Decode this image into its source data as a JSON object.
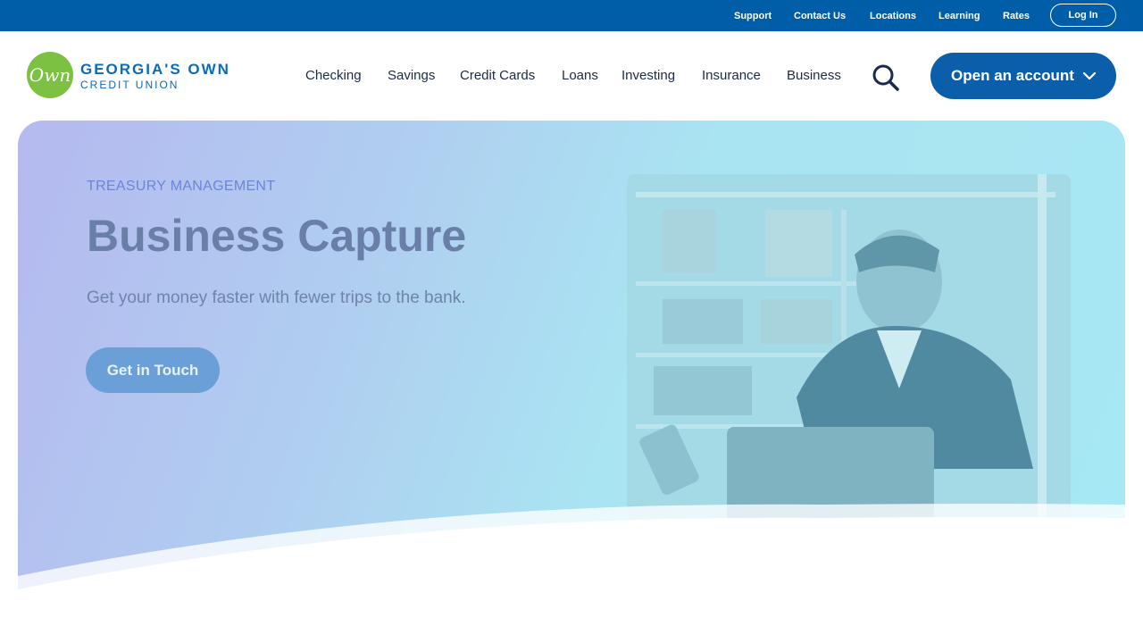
{
  "utility": {
    "links": [
      "Support",
      "Contact Us",
      "Locations",
      "Learning",
      "Rates"
    ],
    "login_label": "Log In"
  },
  "brand": {
    "logo_mark": "Own",
    "name": "GEORGIA'S OWN",
    "sub": "CREDIT UNION"
  },
  "nav": {
    "items": [
      "Checking",
      "Savings",
      "Credit Cards",
      "Loans",
      "Investing",
      "Insurance",
      "Business"
    ],
    "open_account_label": "Open an account"
  },
  "hero": {
    "eyebrow": "TREASURY MANAGEMENT",
    "title": "Business Capture",
    "subtitle": "Get your money faster with fewer trips to the bank.",
    "cta_label": "Get in Touch"
  },
  "colors": {
    "utility_bar": "#005ea8",
    "brand_blue": "#0b6bb3",
    "brand_green": "#7dc142",
    "primary_button": "#0b5ea9"
  },
  "icons": [
    "search-icon",
    "chevron-down-icon"
  ]
}
